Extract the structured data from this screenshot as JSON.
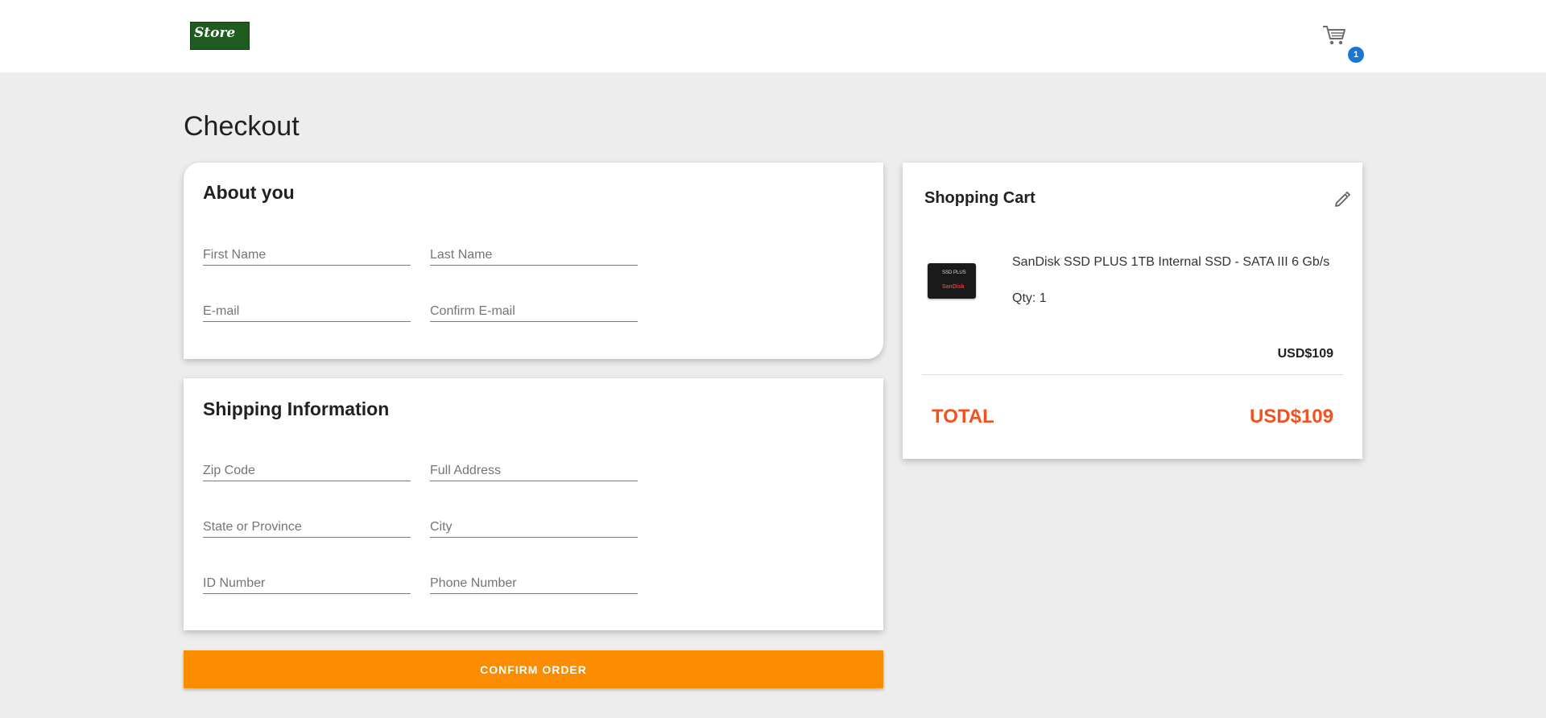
{
  "header": {
    "logo_text": "Store",
    "cart_badge_count": "1"
  },
  "page": {
    "title": "Checkout"
  },
  "about_you": {
    "title": "About you",
    "fields": {
      "first_name": "First Name",
      "last_name": "Last Name",
      "email": "E-mail",
      "confirm_email": "Confirm E-mail"
    }
  },
  "shipping": {
    "title": "Shipping Information",
    "fields": {
      "zip_code": "Zip Code",
      "full_address": "Full Address",
      "state": "State or Province",
      "city": "City",
      "id_number": "ID Number",
      "phone_number": "Phone Number"
    }
  },
  "confirm_button": "CONFIRM ORDER",
  "cart": {
    "title": "Shopping Cart",
    "items": [
      {
        "name": "SanDisk SSD PLUS 1TB Internal SSD - SATA III 6 Gb/s",
        "qty_label": "Qty: 1",
        "price": "USD$109",
        "image_label_top": "SSD PLUS",
        "image_label_brand": "SanDisk"
      }
    ],
    "total_label": "TOTAL",
    "total_value": "USD$109"
  },
  "colors": {
    "accent_orange": "#fb8c00",
    "total_red": "#f4511e",
    "badge_blue": "#1976d2",
    "logo_green": "#1f5c1f"
  }
}
